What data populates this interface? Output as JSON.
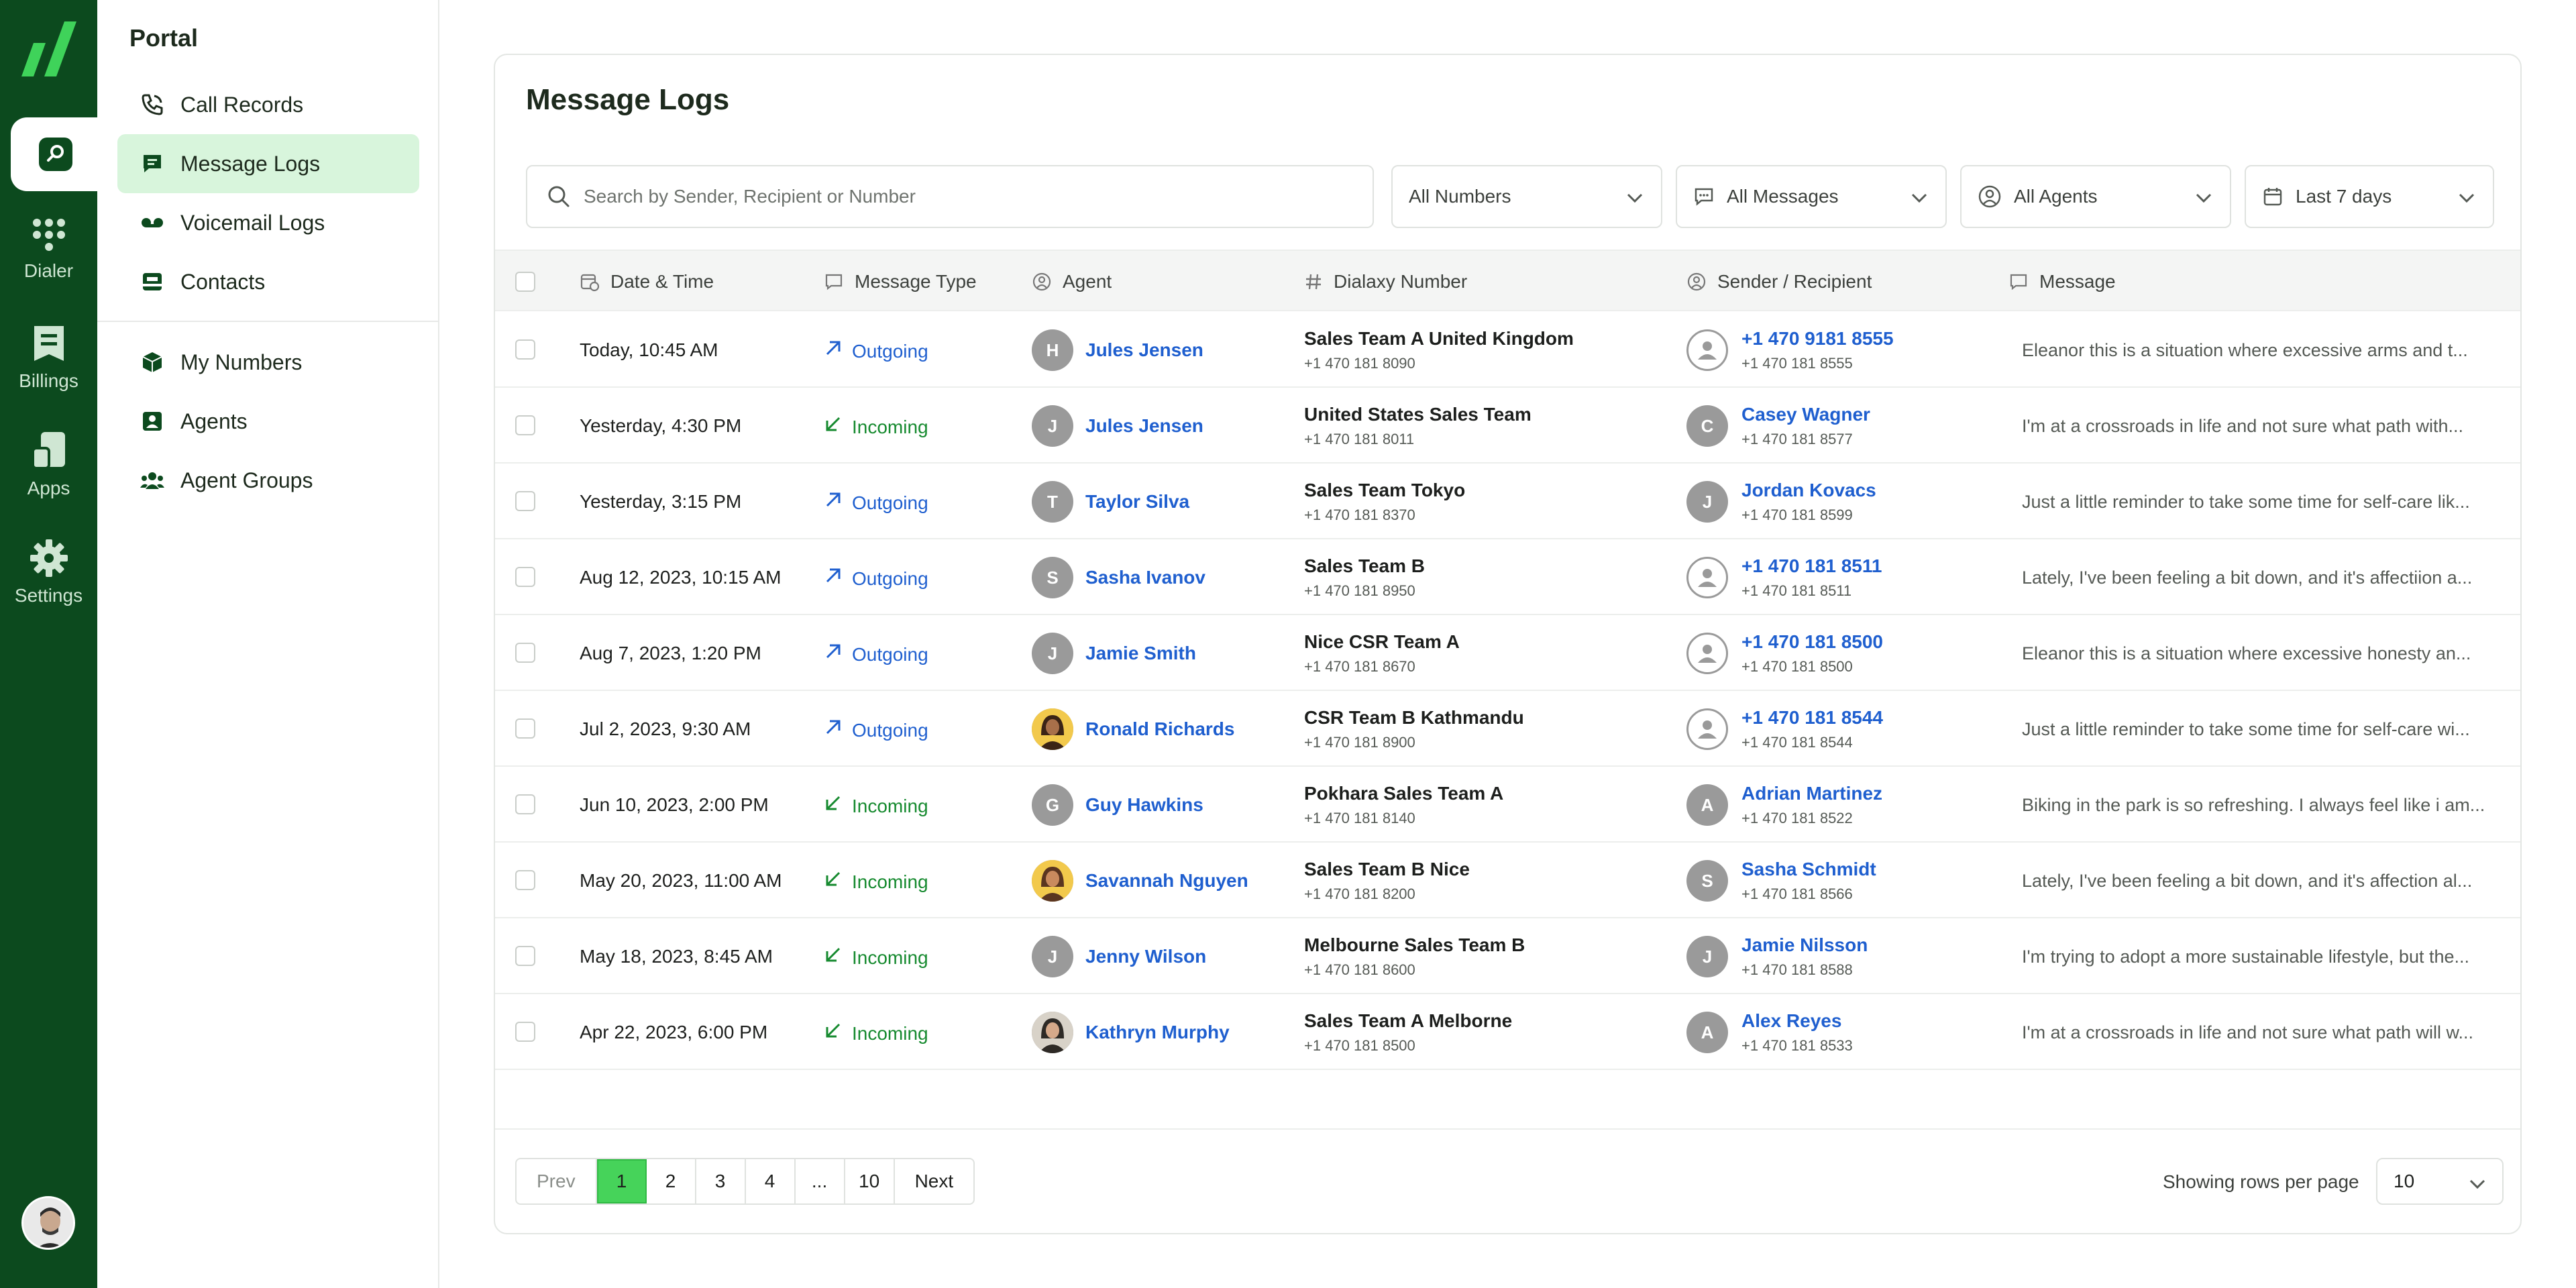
{
  "rail": {
    "items": [
      {
        "label": "Dialer",
        "icon": "dialpad-icon"
      },
      {
        "label": "Billings",
        "icon": "billing-icon"
      },
      {
        "label": "Apps",
        "icon": "apps-icon"
      },
      {
        "label": "Settings",
        "icon": "gear-icon"
      }
    ]
  },
  "subnav": {
    "title": "Portal",
    "items": [
      {
        "label": "Call Records",
        "icon": "phone-icon"
      },
      {
        "label": "Message Logs",
        "icon": "message-icon",
        "active": true
      },
      {
        "label": "Voicemail Logs",
        "icon": "voicemail-icon"
      },
      {
        "label": "Contacts",
        "icon": "contacts-icon"
      },
      {
        "label": "My Numbers",
        "icon": "cube-icon"
      },
      {
        "label": "Agents",
        "icon": "agent-icon"
      },
      {
        "label": "Agent Groups",
        "icon": "agent-group-icon"
      }
    ]
  },
  "page": {
    "title": "Message Logs"
  },
  "filters": {
    "search_placeholder": "Search by Sender, Recipient or Number",
    "numbers": "All Numbers",
    "messages": "All Messages",
    "agents": "All Agents",
    "date_range": "Last 7 days"
  },
  "table": {
    "headers": {
      "datetime": "Date & Time",
      "message_type": "Message Type",
      "agent": "Agent",
      "dialaxy_number": "Dialaxy Number",
      "sender_recipient": "Sender / Recipient",
      "message": "Message"
    },
    "rows": [
      {
        "datetime": "Today, 10:45 AM",
        "type": "Outgoing",
        "agent_initial": "H",
        "agent": "Jules Jensen",
        "num_title": "Sales Team A United Kingdom",
        "num_sub": "+1 470 181 8090",
        "snd_initial": "",
        "snd_name": "+1 470 9181 8555",
        "snd_sub": "+1 470 181 8555",
        "message": "Eleanor this is a situation where excessive  arms and t..."
      },
      {
        "datetime": "Yesterday, 4:30 PM",
        "type": "Incoming",
        "agent_initial": "J",
        "agent": "Jules Jensen",
        "num_title": "United States Sales Team",
        "num_sub": "+1 470 181 8011",
        "snd_initial": "C",
        "snd_name": "Casey Wagner",
        "snd_sub": "+1 470 181 8577",
        "message": "I'm at a crossroads in life and not sure what path with..."
      },
      {
        "datetime": "Yesterday, 3:15 PM",
        "type": "Outgoing",
        "agent_initial": "T",
        "agent": "Taylor Silva",
        "num_title": "Sales Team  Tokyo",
        "num_sub": "+1 470 181 8370",
        "snd_initial": "J",
        "snd_name": "Jordan Kovacs",
        "snd_sub": "+1 470 181 8599",
        "message": "Just a little reminder to take some time for self-care lik..."
      },
      {
        "datetime": "Aug 12, 2023, 10:15 AM",
        "type": "Outgoing",
        "agent_initial": "S",
        "agent": "Sasha Ivanov",
        "num_title": "Sales Team B",
        "num_sub": "+1 470 181 8950",
        "snd_initial": "",
        "snd_name": "+1 470 181 8511",
        "snd_sub": "+1 470 181 8511",
        "message": "Lately, I've been feeling a bit down, and it's affectiion a..."
      },
      {
        "datetime": "Aug 7, 2023, 1:20 PM",
        "type": "Outgoing",
        "agent_initial": "J",
        "agent": "Jamie Smith",
        "num_title": "Nice  CSR Team A",
        "num_sub": "+1 470 181 8670",
        "snd_initial": "",
        "snd_name": "+1 470 181 8500",
        "snd_sub": "+1 470 181 8500",
        "message": "Eleanor this is a situation where excessive honesty an..."
      },
      {
        "datetime": "Jul 2, 2023, 9:30 AM",
        "type": "Outgoing",
        "agent_initial": "",
        "agent": "Ronald Richards",
        "num_title": "CSR Team B Kathmandu",
        "num_sub": "+1 470 181 8900",
        "snd_initial": "",
        "snd_name": "+1 470 181 8544",
        "snd_sub": "+1 470 181 8544",
        "message": "Just a little reminder to take some time for self-care wi..."
      },
      {
        "datetime": "Jun 10, 2023, 2:00 PM",
        "type": "Incoming",
        "agent_initial": "G",
        "agent": "Guy Hawkins",
        "num_title": "Pokhara Sales Team A",
        "num_sub": "+1 470 181 8140",
        "snd_initial": "A",
        "snd_name": "Adrian Martinez",
        "snd_sub": "+1 470 181 8522",
        "message": "Biking in the park is so refreshing. I always feel like i am..."
      },
      {
        "datetime": "May 20, 2023, 11:00 AM",
        "type": "Incoming",
        "agent_initial": "",
        "agent": "Savannah Nguyen",
        "num_title": "Sales Team B Nice",
        "num_sub": "+1 470 181 8200",
        "snd_initial": "S",
        "snd_name": "Sasha Schmidt",
        "snd_sub": "+1 470 181 8566",
        "message": "Lately, I've been feeling a bit down, and it's affection al..."
      },
      {
        "datetime": "May 18, 2023, 8:45 AM",
        "type": "Incoming",
        "agent_initial": "J",
        "agent": "Jenny Wilson",
        "num_title": "Melbourne  Sales Team B",
        "num_sub": "+1 470 181 8600",
        "snd_initial": "J",
        "snd_name": "Jamie Nilsson",
        "snd_sub": "+1 470 181 8588",
        "message": "I'm trying to adopt a more sustainable lifestyle, but the..."
      },
      {
        "datetime": "Apr 22, 2023, 6:00 PM",
        "type": "Incoming",
        "agent_initial": "",
        "agent": "Kathryn Murphy",
        "num_title": "Sales Team A Melborne",
        "num_sub": "+1 470 181 8500",
        "snd_initial": "A",
        "snd_name": "Alex Reyes",
        "snd_sub": "+1 470 181 8533",
        "message": "I'm at a crossroads in life and not sure what path will w..."
      }
    ]
  },
  "pagination": {
    "prev": "Prev",
    "pages": [
      "1",
      "2",
      "3",
      "4",
      "...",
      "10"
    ],
    "current": "1",
    "next": "Next",
    "rows_label": "Showing rows per page",
    "rows_value": "10"
  },
  "colors": {
    "rail_bg": "#0c4a1e",
    "accent_green": "#46d35a",
    "active_nav_bg": "#d8f5dc",
    "link_blue": "#1f5fcf",
    "incoming_green": "#168a2f"
  }
}
